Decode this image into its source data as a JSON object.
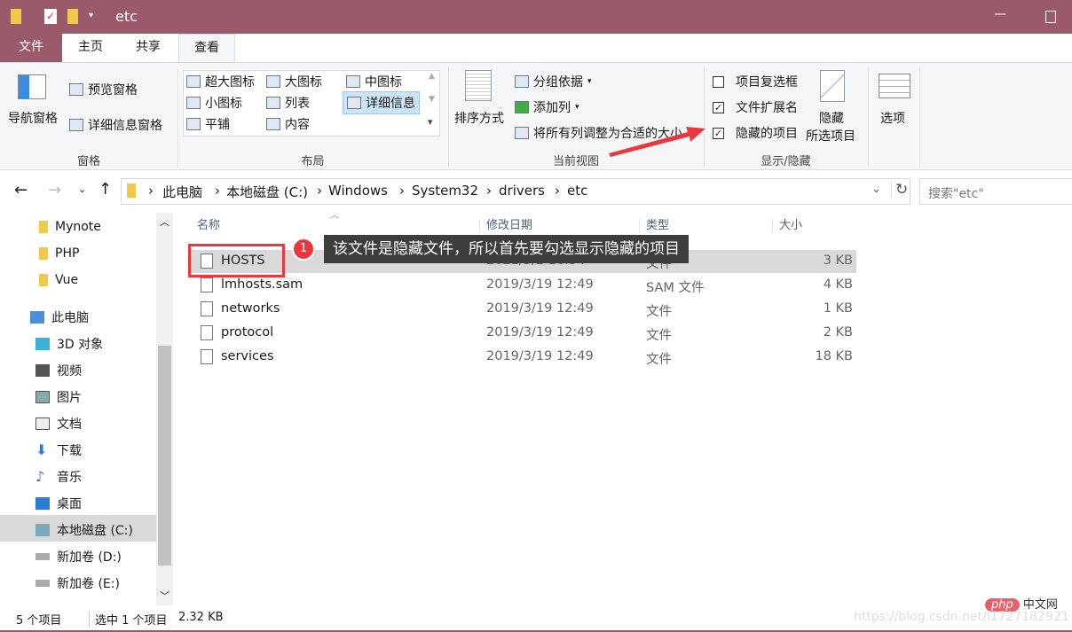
{
  "window": {
    "title": "etc",
    "accent": "#9b5a69",
    "minimize": "—",
    "maximize": "☐"
  },
  "tabs": [
    "文件",
    "主页",
    "共享",
    "查看"
  ],
  "ribbon": {
    "panes": {
      "nav": "导航窗格",
      "preview": "预览窗格",
      "details": "详细信息窗格",
      "label": "窗格"
    },
    "layout": {
      "items": [
        "超大图标",
        "大图标",
        "中图标",
        "小图标",
        "列表",
        "详细信息",
        "平铺",
        "内容"
      ],
      "selected": "详细信息",
      "label": "布局"
    },
    "view": {
      "sort": "排序方式",
      "group": "分组依据",
      "add_col": "添加列",
      "fit": "将所有列调整为合适的大小",
      "label": "当前视图"
    },
    "showhide": {
      "checkbox_items": "项目复选框",
      "ext": "文件扩展名",
      "hidden": "隐藏的项目",
      "hide_sel_1": "隐藏",
      "hide_sel_2": "所选项目",
      "label": "显示/隐藏",
      "checks": {
        "checkbox_items": false,
        "ext": true,
        "hidden": true
      }
    },
    "options": "选项"
  },
  "address": {
    "crumbs": [
      "此电脑",
      "本地磁盘 (C:)",
      "Windows",
      "System32",
      "drivers",
      "etc"
    ],
    "search_placeholder": "搜索\"etc\""
  },
  "sidebar": [
    "Mynote",
    "PHP",
    "Vue",
    "此电脑",
    "3D 对象",
    "视频",
    "图片",
    "文档",
    "下载",
    "音乐",
    "桌面",
    "本地磁盘 (C:)",
    "新加卷 (D:)",
    "新加卷 (E:)"
  ],
  "columns": [
    "名称",
    "修改日期",
    "类型",
    "大小"
  ],
  "files": [
    {
      "name": "HOSTS",
      "date": "2021/3/2 16:34",
      "type": "文件",
      "size": "3 KB"
    },
    {
      "name": "lmhosts.sam",
      "date": "2019/3/19 12:49",
      "type": "SAM 文件",
      "size": "4 KB"
    },
    {
      "name": "networks",
      "date": "2019/3/19 12:49",
      "type": "文件",
      "size": "1 KB"
    },
    {
      "name": "protocol",
      "date": "2019/3/19 12:49",
      "type": "文件",
      "size": "2 KB"
    },
    {
      "name": "services",
      "date": "2019/3/19 12:49",
      "type": "文件",
      "size": "18 KB"
    }
  ],
  "annotation": {
    "number": "1",
    "text": "该文件是隐藏文件，所以首先要勾选显示隐藏的项目"
  },
  "status": {
    "count": "5 个项目",
    "selected": "选中 1 个项目",
    "size": "2.32 KB"
  },
  "watermark": {
    "logo": "php 中文网",
    "url": "https://blog.csdn.net/l1727182921"
  }
}
